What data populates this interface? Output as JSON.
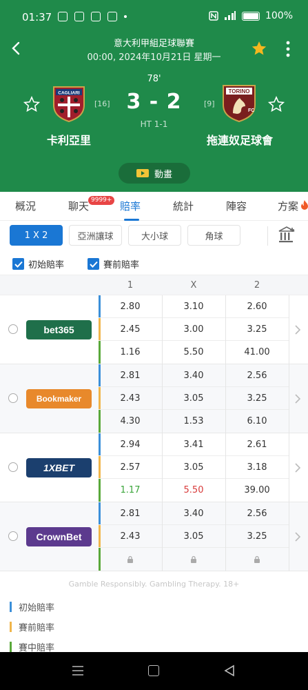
{
  "status_bar": {
    "time": "01:37",
    "battery": "100%"
  },
  "match": {
    "league": "意大利甲組足球聯賽",
    "datetime": "00:00, 2024年10月21日 星期一",
    "minute": "78'",
    "score": "3 - 2",
    "half_time": "HT 1-1",
    "home": {
      "name": "卡利亞里",
      "rank": "[16]",
      "logo_text": "CAGLIARI",
      "color": "#a01e2c"
    },
    "away": {
      "name": "拖連奴足球會",
      "rank": "[9]",
      "logo_text": "TORINO",
      "color": "#7a1e1e"
    },
    "animation_label": "動畫"
  },
  "tabs": [
    "概況",
    "聊天",
    "賠率",
    "統計",
    "陣容",
    "方案"
  ],
  "active_tab": "賠率",
  "chat_badge": "9999+",
  "subtabs": [
    "1 X 2",
    "亞洲讓球",
    "大小球",
    "角球"
  ],
  "filters": {
    "initial": "初始賠率",
    "pre_match": "賽前賠率"
  },
  "columns": [
    "1",
    "X",
    "2"
  ],
  "bookmakers": [
    {
      "name": "bet365",
      "logo_color": "#1f6f4a",
      "rows": [
        [
          "2.80",
          "3.10",
          "2.60"
        ],
        [
          "2.45",
          "3.00",
          "3.25"
        ],
        [
          "1.16",
          "5.50",
          "41.00"
        ]
      ]
    },
    {
      "name": "Bookmaker",
      "logo_color": "#e8892b",
      "rows": [
        [
          "2.81",
          "3.40",
          "2.56"
        ],
        [
          "2.43",
          "3.05",
          "3.25"
        ],
        [
          "4.30",
          "1.53",
          "6.10"
        ]
      ]
    },
    {
      "name": "1XBET",
      "logo_color": "#1b3f6e",
      "rows": [
        [
          "2.94",
          "3.41",
          "2.61"
        ],
        [
          "2.57",
          "3.05",
          "3.18"
        ],
        [
          "1.17",
          "5.50",
          "39.00"
        ]
      ]
    },
    {
      "name": "CrownBet",
      "logo_color": "#5c3a8e",
      "rows": [
        [
          "2.81",
          "3.40",
          "2.56"
        ],
        [
          "2.43",
          "3.05",
          "3.25"
        ]
      ]
    }
  ],
  "disclaimer": "Gamble Responsibly. Gambling Therapy. 18+",
  "legend": [
    "初始賠率",
    "賽前賠率",
    "賽中賠率"
  ],
  "colors": {
    "header": "#1f8a4a",
    "accent": "#1a77d4",
    "initial": "#3b8fd9",
    "pre_match": "#f0b54a",
    "in_play": "#59a83a"
  }
}
